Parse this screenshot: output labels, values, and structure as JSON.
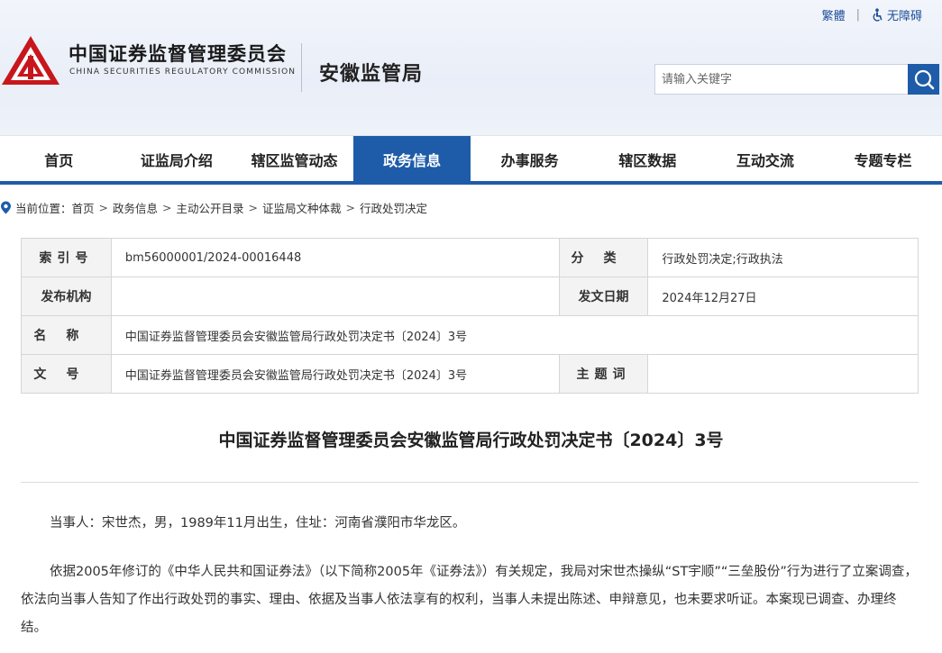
{
  "top_links": {
    "traditional": "繁體",
    "separator": "|",
    "accessibility": "无障碍"
  },
  "logo": {
    "cn": "中国证券监督管理委员会",
    "en": "CHINA SECURITIES REGULATORY COMMISSION"
  },
  "bureau": "安徽监管局",
  "search": {
    "placeholder": "请输入关键字"
  },
  "nav": {
    "items": [
      {
        "label": "首页"
      },
      {
        "label": "证监局介绍"
      },
      {
        "label": "辖区监管动态"
      },
      {
        "label": "政务信息",
        "active": true
      },
      {
        "label": "办事服务"
      },
      {
        "label": "辖区数据"
      },
      {
        "label": "互动交流"
      },
      {
        "label": "专题专栏"
      }
    ]
  },
  "breadcrumb": {
    "prefix": "当前位置：",
    "items": [
      "首页",
      "政务信息",
      "主动公开目录",
      "证监局文种体裁",
      "行政处罚决定"
    ],
    "separator": ">"
  },
  "info": {
    "index_label": "索引号",
    "index_value": "bm56000001/2024-00016448",
    "category_label": "分类",
    "category_value": "行政处罚决定;行政执法",
    "publisher_label": "发布机构",
    "publisher_value": "",
    "date_label": "发文日期",
    "date_value": "2024年12月27日",
    "name_label": "名称",
    "name_value": "中国证券监督管理委员会安徽监管局行政处罚决定书〔2024〕3号",
    "doc_no_label": "文号",
    "doc_no_value": "中国证券监督管理委员会安徽监管局行政处罚决定书〔2024〕3号",
    "keywords_label": "主题词",
    "keywords_value": ""
  },
  "article": {
    "title": "中国证券监督管理委员会安徽监管局行政处罚决定书〔2024〕3号",
    "paragraphs": [
      "当事人：宋世杰，男，1989年11月出生，住址：河南省濮阳市华龙区。",
      "依据2005年修订的《中华人民共和国证券法》（以下简称2005年《证券法》）有关规定，我局对宋世杰操纵“ST宇顺”“三垒股份”行为进行了立案调查，依法向当事人告知了作出行政处罚的事实、理由、依据及当事人依法享有的权利，当事人未提出陈述、申辩意见，也未要求听证。本案现已调查、办理终结。"
    ]
  },
  "colors": {
    "brand_blue": "#1e5ca9",
    "logo_red": "#c8161d"
  }
}
